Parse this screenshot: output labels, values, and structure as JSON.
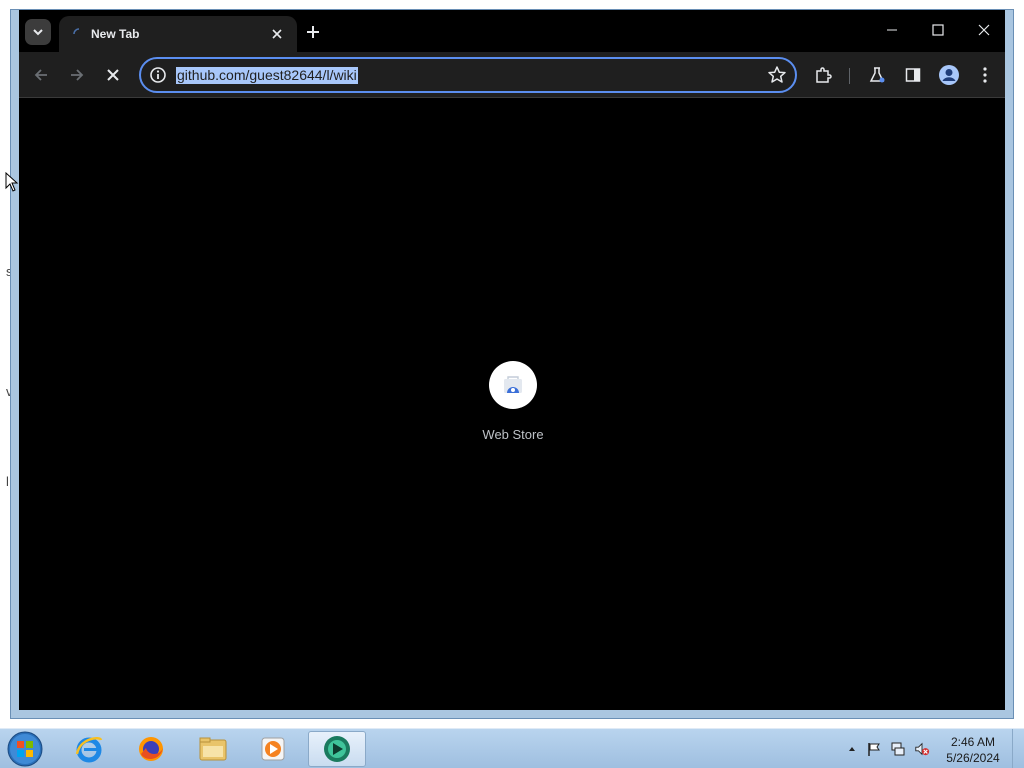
{
  "browser": {
    "tab": {
      "title": "New Tab"
    },
    "omnibox": {
      "url": "github.com/guest82644/l/wiki"
    },
    "new_tab_page": {
      "shortcuts": [
        {
          "label": "Web Store"
        }
      ]
    }
  },
  "colors": {
    "omnibox_focus": "#5b8ef0",
    "url_selection": "#a8c7fa",
    "page_background": "#000000",
    "toolbar_background": "#1f1f1f"
  },
  "icons": [
    "chevron-down-icon",
    "close-icon",
    "plus-icon",
    "minimize-icon",
    "maximize-icon",
    "back-icon",
    "forward-icon",
    "stop-icon",
    "info-icon",
    "star-icon",
    "extensions-icon",
    "labs-icon",
    "side-panel-icon",
    "profile-icon",
    "menu-icon",
    "windows-start-icon",
    "ie-icon",
    "firefox-icon",
    "explorer-icon",
    "media-player-icon",
    "app-icon",
    "tray-arrow-icon",
    "flag-icon",
    "network-icon",
    "volume-muted-icon"
  ],
  "taskbar": {
    "clock": {
      "time": "2:46 AM",
      "date": "5/26/2024"
    }
  }
}
